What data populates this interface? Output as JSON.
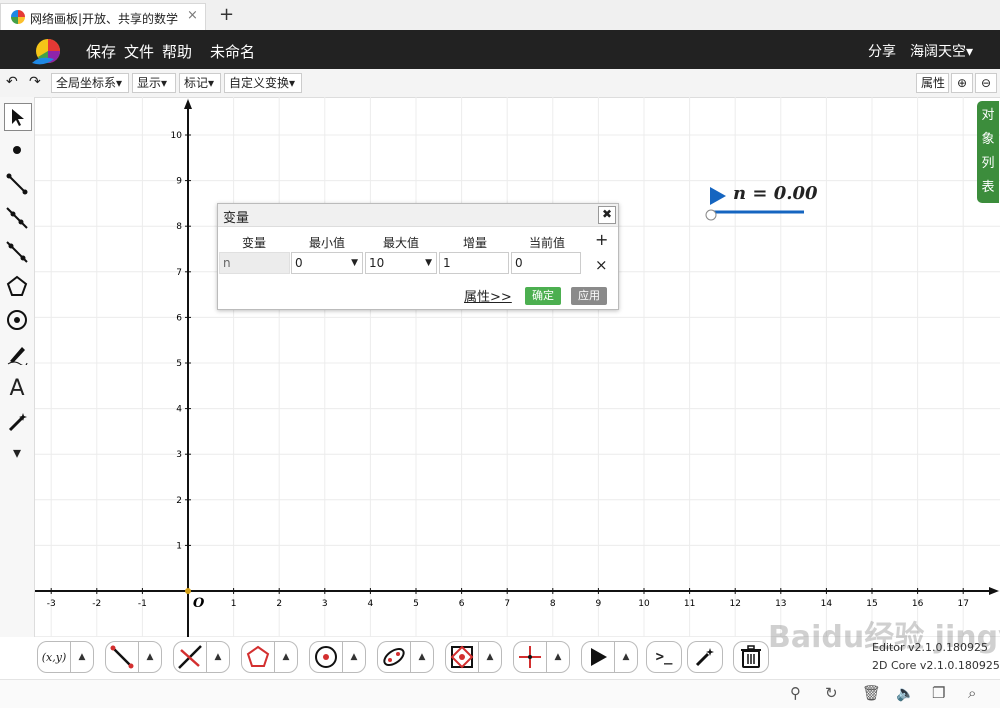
{
  "browser": {
    "tab_title": "网络画板|开放、共享的数学",
    "tab_close": "×",
    "new_tab": "+"
  },
  "header": {
    "menu": [
      "保存",
      "文件",
      "帮助"
    ],
    "doc_name": "未命名",
    "share": "分享",
    "user": "海阔天空▾"
  },
  "toolbar": {
    "undo": "↶",
    "redo": "↷",
    "coord_menu": "全局坐标系▾",
    "display_menu": "显示▾",
    "mark_menu": "标记▾",
    "transform_menu": "自定义变换▾",
    "properties": "属性",
    "zoom_in": "⊕",
    "zoom_out": "⊖"
  },
  "palette": {
    "tools": [
      "select-arrow-icon",
      "point-icon",
      "segment-icon",
      "ray-icon",
      "line-icon",
      "polygon-icon",
      "circle-icon",
      "pen-icon",
      "text-icon",
      "magic-wand-icon",
      "more-down-icon"
    ],
    "text_glyph": "A",
    "more_glyph": "▾"
  },
  "object_list": "对象列表",
  "canvas": {
    "x_ticks": [
      "-3",
      "-2",
      "-1",
      "1",
      "2",
      "3",
      "4",
      "5",
      "6",
      "7",
      "8",
      "9",
      "10",
      "11",
      "12",
      "13",
      "14",
      "15",
      "16",
      "17"
    ],
    "y_ticks": [
      "1",
      "2",
      "3",
      "4",
      "5",
      "6",
      "7",
      "8",
      "9",
      "10"
    ],
    "origin": "O"
  },
  "slider": {
    "label": "n = 0.00",
    "value": 0
  },
  "dialog": {
    "title": "变量",
    "close": "✖",
    "columns": [
      "变量",
      "最小值",
      "最大值",
      "增量",
      "当前值"
    ],
    "add": "+",
    "row": {
      "name": "n",
      "min": "0",
      "max": "10",
      "step": "1",
      "current": "0"
    },
    "delete": "×",
    "properties_link": "属性>>",
    "ok": "确定",
    "apply": "应用"
  },
  "bottom_tools": [
    {
      "name": "coordinate-tool",
      "glyph": "(x,y)"
    },
    {
      "name": "segment-tool"
    },
    {
      "name": "perpendicular-tool"
    },
    {
      "name": "polygon-tool"
    },
    {
      "name": "circle-tool"
    },
    {
      "name": "conic-tool"
    },
    {
      "name": "transform-tool"
    },
    {
      "name": "axis-tool"
    },
    {
      "name": "play-tool"
    },
    {
      "name": "command-tool",
      "glyph": ">_"
    },
    {
      "name": "magic-tool"
    },
    {
      "name": "delete-tool"
    }
  ],
  "bottom_arrow": "▲",
  "version": {
    "editor": "Editor v2.1.0.180925",
    "core": "2D Core v2.1.0.180925"
  },
  "watermark": "Baidu经验 jingyan.baidu.com"
}
